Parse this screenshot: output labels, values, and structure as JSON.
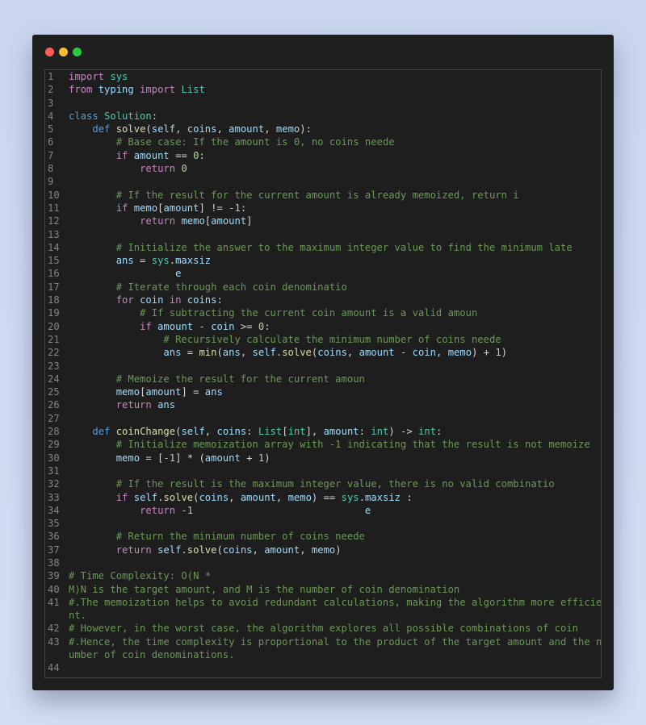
{
  "window": {
    "title": ""
  },
  "lines": [
    {
      "n": "1",
      "t": "import sys"
    },
    {
      "n": "2",
      "t": "from typing import List"
    },
    {
      "n": "3",
      "t": ""
    },
    {
      "n": "4",
      "t": "class Solution:"
    },
    {
      "n": "5",
      "t": "    def solve(self, coins, amount, memo):"
    },
    {
      "n": "6",
      "t": "        # Base case: If the amount is 0, no coins neede"
    },
    {
      "n": "7",
      "t": "        if amount == 0:"
    },
    {
      "n": "8",
      "t": "            return 0"
    },
    {
      "n": "9",
      "t": ""
    },
    {
      "n": "10",
      "t": "        # If the result for the current amount is already memoized, return i"
    },
    {
      "n": "11",
      "t": "        if memo[amount] != -1:"
    },
    {
      "n": "12",
      "t": "            return memo[amount]"
    },
    {
      "n": "13",
      "t": ""
    },
    {
      "n": "14",
      "t": "        # Initialize the answer to the maximum integer value to find the minimum late"
    },
    {
      "n": "15",
      "t": "        ans = sys.maxsiz"
    },
    {
      "n": "16",
      "t": "                  e"
    },
    {
      "n": "17",
      "t": "        # Iterate through each coin denominatio"
    },
    {
      "n": "18",
      "t": "        for coin in coins:"
    },
    {
      "n": "19",
      "t": "            # If subtracting the current coin amount is a valid amoun"
    },
    {
      "n": "20",
      "t": "            if amount - coin >= 0:"
    },
    {
      "n": "21",
      "t": "                # Recursively calculate the minimum number of coins neede"
    },
    {
      "n": "22",
      "t": "                ans = min(ans, self.solve(coins, amount - coin, memo) + 1)"
    },
    {
      "n": "23",
      "t": ""
    },
    {
      "n": "24",
      "t": "        # Memoize the result for the current amoun"
    },
    {
      "n": "25",
      "t": "        memo[amount] = ans"
    },
    {
      "n": "26",
      "t": "        return ans"
    },
    {
      "n": "27",
      "t": ""
    },
    {
      "n": "28",
      "t": "    def coinChange(self, coins: List[int], amount: int) -> int:"
    },
    {
      "n": "29",
      "t": "        # Initialize memoization array with -1 indicating that the result is not memoize"
    },
    {
      "n": "30",
      "t": "        memo = [-1] * (amount + 1)"
    },
    {
      "n": "31",
      "t": ""
    },
    {
      "n": "32",
      "t": "        # If the result is the maximum integer value, there is no valid combinatio"
    },
    {
      "n": "33",
      "t": "        if self.solve(coins, amount, memo) == sys.maxsiz :"
    },
    {
      "n": "34",
      "t": "            return -1                             e"
    },
    {
      "n": "35",
      "t": ""
    },
    {
      "n": "36",
      "t": "        # Return the minimum number of coins neede"
    },
    {
      "n": "37",
      "t": "        return self.solve(coins, amount, memo)"
    },
    {
      "n": "38",
      "t": ""
    },
    {
      "n": "39",
      "t": "# Time Complexity: O(N *"
    },
    {
      "n": "40",
      "t": "M)N is the target amount, and M is the number of coin denomination"
    },
    {
      "n": "41",
      "t": "#.The memoization helps to avoid redundant calculations, making the algorithm more efficie",
      "t2": "nt."
    },
    {
      "n": "42",
      "t": "# However, in the worst case, the algorithm explores all possible combinations of coin"
    },
    {
      "n": "43",
      "t": "#.Hence, the time complexity is proportional to the product of the target amount and the n",
      "t2": "umber of coin denominations."
    },
    {
      "n": "44",
      "t": ""
    }
  ]
}
